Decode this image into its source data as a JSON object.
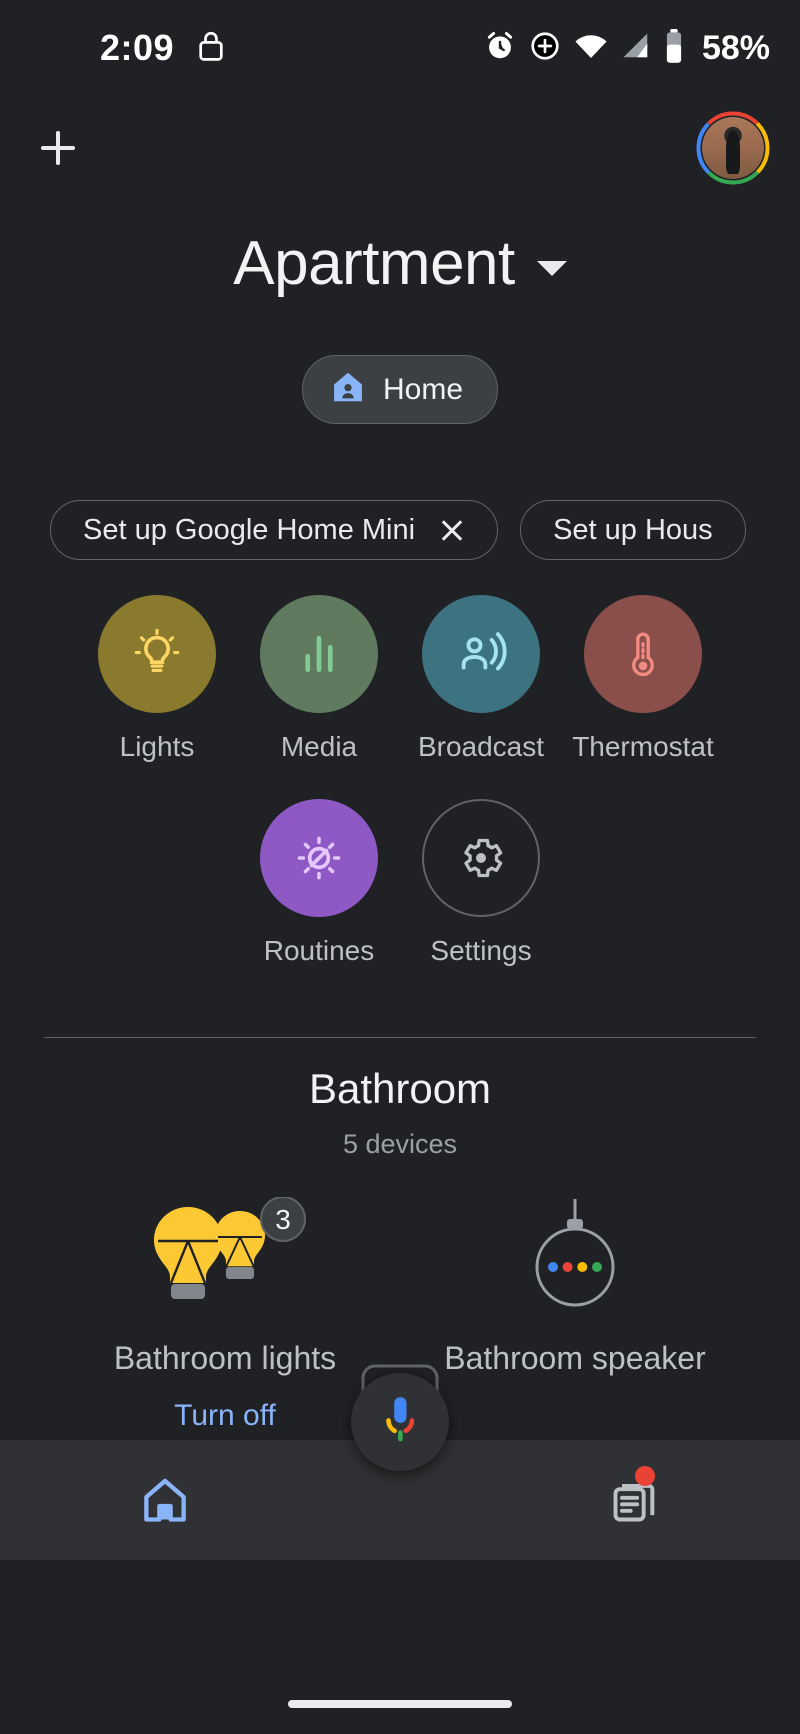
{
  "status_bar": {
    "time": "2:09",
    "battery_text": "58%",
    "icons": [
      "lock-icon",
      "alarm-icon",
      "dnd-icon",
      "wifi-icon",
      "signal-icon",
      "battery-icon"
    ]
  },
  "app_bar": {
    "add_label": "+",
    "avatar_name": "account-avatar"
  },
  "header": {
    "home_name": "Apartment",
    "dropdown_icon": "chevron-down-icon",
    "tab": {
      "label": "Home",
      "icon": "home-icon",
      "selected": true
    }
  },
  "setup_chips": [
    {
      "label": "Set up Google Home Mini",
      "dismissable": true
    },
    {
      "label": "Set up Hous",
      "dismissable": false
    }
  ],
  "quick_actions": [
    {
      "label": "Lights",
      "icon": "lightbulb-icon",
      "bg": "#8a7a2e",
      "fg": "#fdd663"
    },
    {
      "label": "Media",
      "icon": "equalizer-icon",
      "bg": "#5f7a5f",
      "fg": "#81c995"
    },
    {
      "label": "Broadcast",
      "icon": "broadcast-icon",
      "bg": "#3d7380",
      "fg": "#a7e3ef"
    },
    {
      "label": "Thermostat",
      "icon": "thermometer-icon",
      "bg": "#8a4f4a",
      "fg": "#f28b82"
    },
    {
      "label": "Routines",
      "icon": "routines-icon",
      "bg": "#8e59c4",
      "fg": "#e4c8ff"
    },
    {
      "label": "Settings",
      "icon": "gear-icon",
      "bg": "transparent",
      "fg": "#bdc1c6"
    }
  ],
  "room": {
    "name": "Bathroom",
    "device_count_text": "5 devices",
    "devices": [
      {
        "name": "Bathroom lights",
        "icon": "lightbulbs-icon",
        "badge": "3",
        "action_label": "Turn off"
      },
      {
        "name": "Bathroom speaker",
        "icon": "google-home-mini-icon",
        "badge": "",
        "action_label": ""
      }
    ]
  },
  "assistant": {
    "icon": "google-assistant-mic-icon"
  },
  "bottom_nav": [
    {
      "label": "",
      "icon": "home-icon",
      "selected": true,
      "badge": false
    },
    {
      "label": "",
      "icon": "feed-icon",
      "selected": false,
      "badge": true
    }
  ],
  "colors": {
    "background": "#202124",
    "surface": "#303134",
    "accent_blue": "#8ab4f8",
    "text_primary": "#f1f3f4",
    "text_secondary": "#bdc1c6",
    "badge_red": "#ea4335"
  }
}
